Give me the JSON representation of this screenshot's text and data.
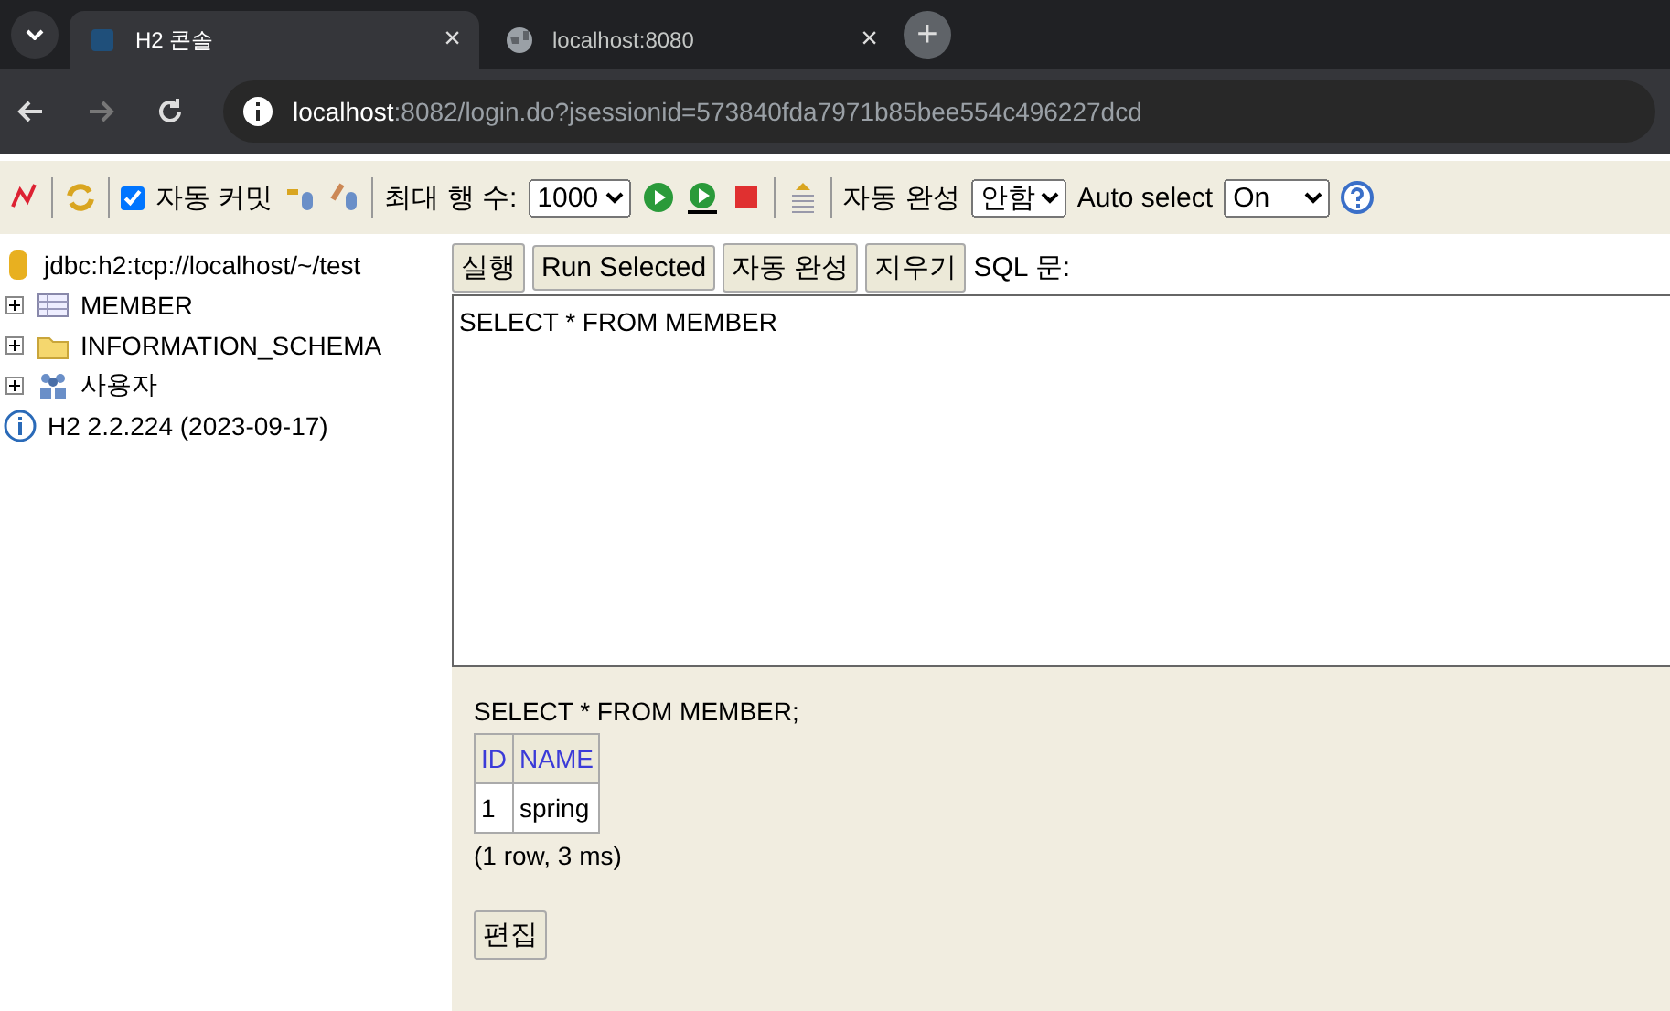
{
  "browser": {
    "tabs": [
      {
        "title": "H2 콘솔",
        "selected": true,
        "close": "×"
      },
      {
        "title": "localhost:8080",
        "selected": false,
        "close": "×"
      }
    ],
    "new_tab": "+",
    "url_host": "localhost",
    "url_rest": ":8082/login.do?jsessionid=573840fda7971b85bee554c496227dcd"
  },
  "toolbar": {
    "auto_commit": {
      "label": "자동 커밋",
      "checked": true
    },
    "max_rows": {
      "label": "최대 행 수:",
      "value": "1000"
    },
    "autocomplete": {
      "label": "자동 완성",
      "value": "안함"
    },
    "auto_select": {
      "label": "Auto select",
      "value": "On"
    }
  },
  "tree": {
    "connection": "jdbc:h2:tcp://localhost/~/test",
    "items": [
      {
        "label": "MEMBER",
        "kind": "table"
      },
      {
        "label": "INFORMATION_SCHEMA",
        "kind": "folder"
      },
      {
        "label": "사용자",
        "kind": "users"
      }
    ],
    "version": "H2 2.2.224 (2023-09-17)"
  },
  "editor": {
    "buttons": [
      "실행",
      "Run Selected",
      "자동 완성",
      "지우기"
    ],
    "label": "SQL 문:",
    "sql": "SELECT * FROM MEMBER"
  },
  "result": {
    "statement": "SELECT * FROM MEMBER;",
    "columns": [
      "ID",
      "NAME"
    ],
    "rows": [
      [
        "1",
        "spring"
      ]
    ],
    "summary": "(1 row, 3 ms)",
    "edit_button": "편집"
  }
}
